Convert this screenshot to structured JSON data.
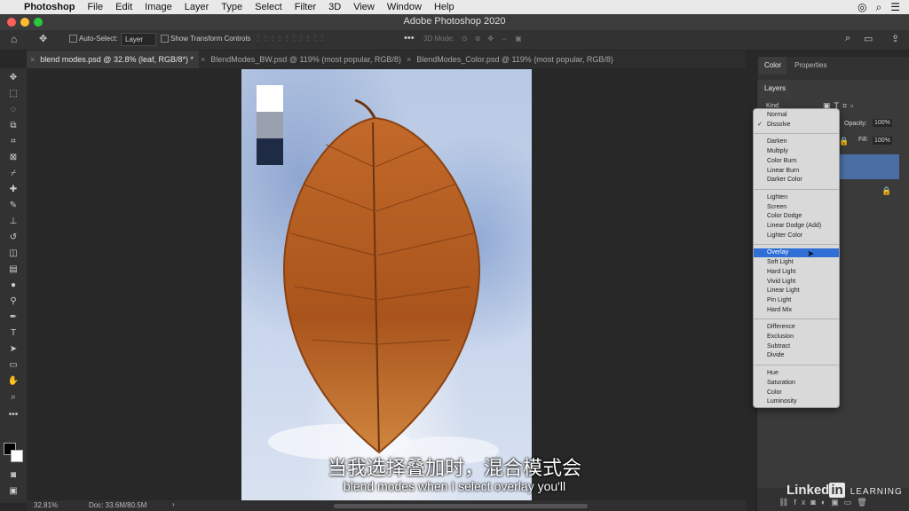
{
  "menubar": {
    "apple": "",
    "app": "Photoshop",
    "items": [
      "File",
      "Edit",
      "Image",
      "Layer",
      "Type",
      "Select",
      "Filter",
      "3D",
      "View",
      "Window",
      "Help"
    ]
  },
  "window": {
    "title": "Adobe Photoshop 2020"
  },
  "options": {
    "auto_select_label": "Auto-Select:",
    "auto_select_value": "Layer",
    "show_transform": "Show Transform Controls",
    "mode_3d": "3D Mode:"
  },
  "tabs": [
    {
      "label": "blend modes.psd @ 32.8% (leaf, RGB/8*) *",
      "active": true
    },
    {
      "label": "BlendModes_BW.psd @ 119% (most popular, RGB/8)",
      "active": false
    },
    {
      "label": "BlendModes_Color.psd @ 119% (most popular, RGB/8)",
      "active": false
    }
  ],
  "status": {
    "zoom": "32.81%",
    "doc": "Doc: 33.6M/80.5M"
  },
  "panels": {
    "tabs": [
      "Color",
      "Properties"
    ],
    "layers_tab": "Layers",
    "kind": "Kind",
    "opacity_label": "Opacity:",
    "opacity_value": "100%",
    "fill_label": "Fill:",
    "fill_value": "100%"
  },
  "blend_menu": {
    "groups": [
      [
        "Normal",
        "Dissolve"
      ],
      [
        "Darken",
        "Multiply",
        "Color Burn",
        "Linear Burn",
        "Darker Color"
      ],
      [
        "Lighten",
        "Screen",
        "Color Dodge",
        "Linear Dodge (Add)",
        "Lighter Color"
      ],
      [
        "Overlay",
        "Soft Light",
        "Hard Light",
        "Vivid Light",
        "Linear Light",
        "Pin Light",
        "Hard Mix"
      ],
      [
        "Difference",
        "Exclusion",
        "Subtract",
        "Divide"
      ],
      [
        "Hue",
        "Saturation",
        "Color",
        "Luminosity"
      ]
    ],
    "checked": "Dissolve",
    "highlighted": "Overlay"
  },
  "subtitles": {
    "chinese": "当我选择叠加时，混合模式会",
    "english": "blend modes when I select overlay you'll"
  },
  "watermark": {
    "brand": "Linked",
    "in": "in",
    "suffix": "LEARNING"
  },
  "colors": {
    "highlight": "#2f6fd6",
    "leaf": "#b05a1c"
  }
}
